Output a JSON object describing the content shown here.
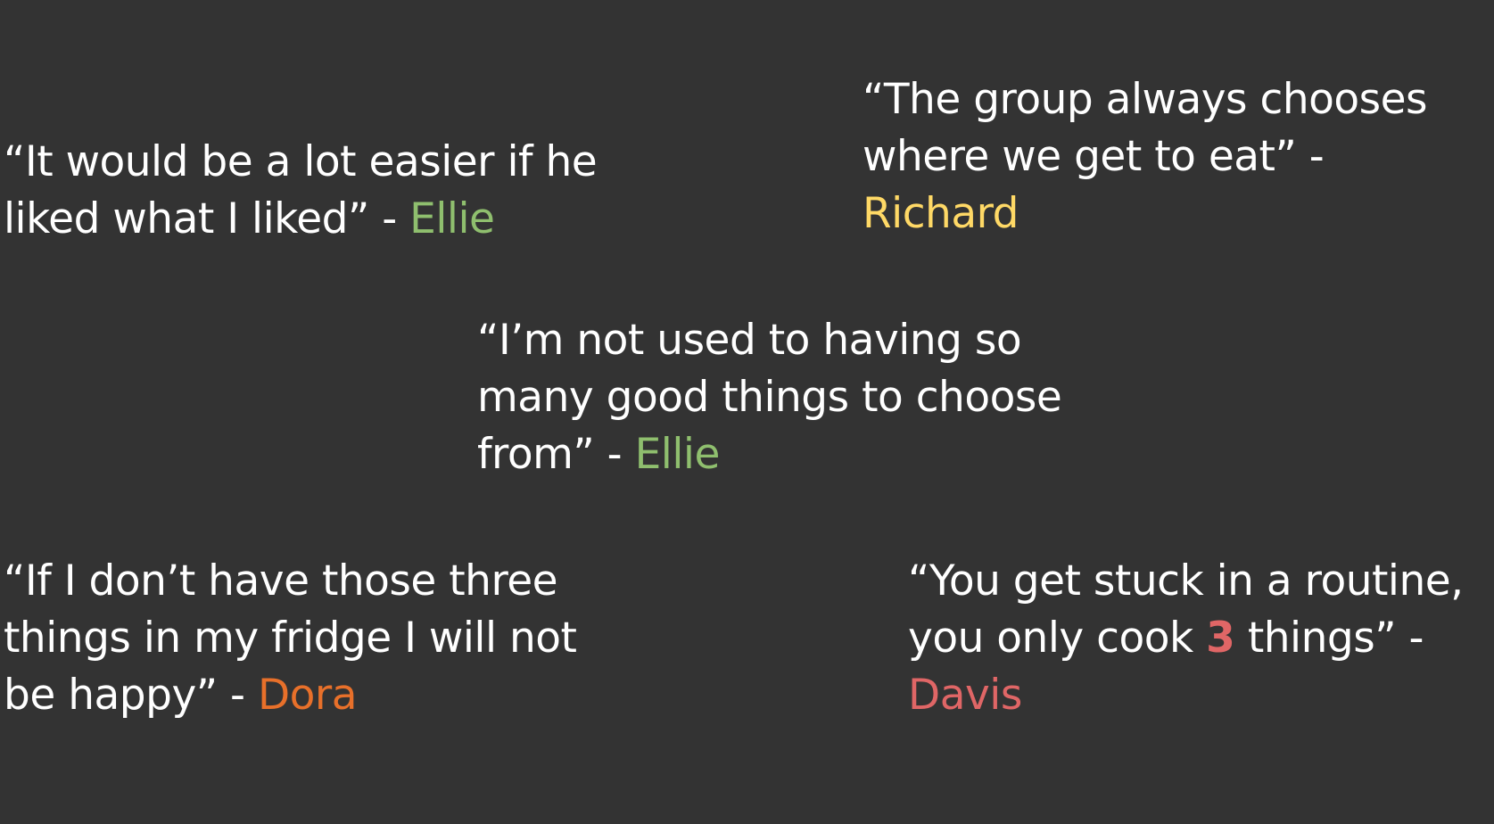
{
  "colors": {
    "background": "#333333",
    "text": "#ffffff",
    "ellie": "#8fbf6e",
    "richard": "#ffd966",
    "dora": "#e8702a",
    "davis": "#e06666"
  },
  "quotes": [
    {
      "lines": [
        "“It would be a lot easier if he",
        "liked what I liked” - "
      ],
      "author": "Ellie"
    },
    {
      "lines": [
        "“The group always chooses",
        "where we get to eat” -"
      ],
      "author": "Richard"
    },
    {
      "lines": [
        "“I’m not used to having so",
        "many good things to choose",
        "from” - "
      ],
      "author": "Ellie"
    },
    {
      "lines": [
        "“If I don’t have those three",
        "things in my fridge I will not",
        "be happy” - "
      ],
      "author": "Dora"
    },
    {
      "lines": [
        "“You get stuck in a routine,",
        "you only cook ",
        " things” -"
      ],
      "number": "3",
      "author": "Davis"
    }
  ]
}
